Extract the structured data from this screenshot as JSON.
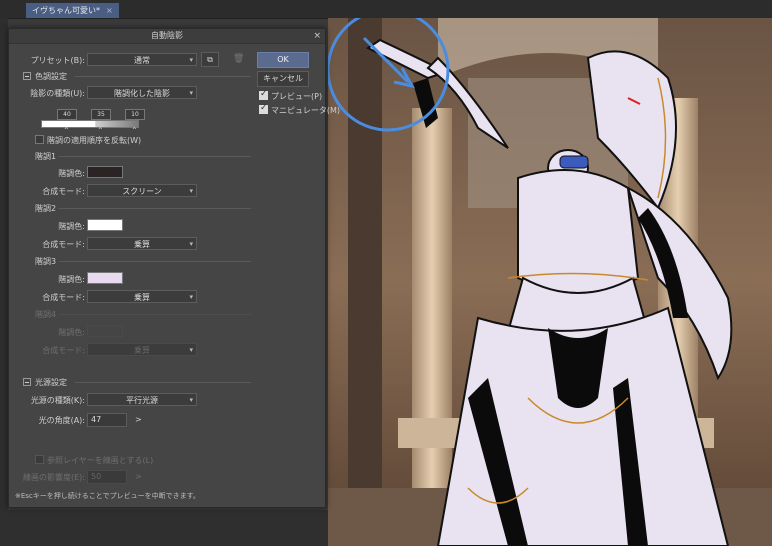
{
  "app": {
    "doc_tab": "イヴちゃん可愛い*",
    "doc_tab_close": "×"
  },
  "dialog": {
    "title": "自動陰影",
    "close": "×",
    "preset_label": "プリセット(B):",
    "preset_value": "通常",
    "ok": "OK",
    "cancel": "キャンセル",
    "preview_label": "プレビュー(P)",
    "preview_checked": true,
    "manipulator_label": "マニピュレータ(M)",
    "manipulator_checked": true,
    "tone_section": "色調設定",
    "shade_type_label": "陰影の種類(U):",
    "shade_type_value": "階調化した陰影",
    "gradient_values": [
      "40",
      "35",
      "10"
    ],
    "reverse_label": "階調の適用順序を反転(W)",
    "tones": [
      {
        "title": "階調1",
        "color_label": "階調色:",
        "color": "#2b2424",
        "blend_label": "合成モード:",
        "blend": "スクリーン"
      },
      {
        "title": "階調2",
        "color_label": "階調色:",
        "color": "#ffffff",
        "blend_label": "合成モード:",
        "blend": "乗算"
      },
      {
        "title": "階調3",
        "color_label": "階調色:",
        "color": "#e7d9ee",
        "blend_label": "合成モード:",
        "blend": "乗算"
      },
      {
        "title": "階調4",
        "color_label": "階調色:",
        "color": "#454545",
        "blend_label": "合成モード:",
        "blend": "乗算"
      }
    ],
    "light_section": "光源設定",
    "light_type_label": "光源の種類(K):",
    "light_type_value": "平行光源",
    "angle_label": "光の角度(A):",
    "angle_value": "47",
    "ref_layer_label": "参照レイヤーを線画とする(L)",
    "line_influence_label": "線画の影響度(E):",
    "line_influence_value": "50",
    "footer": "※Escキーを押し続けることでプレビューを中断できます。"
  },
  "icons": {
    "dropdown": "▾",
    "increment": ">",
    "preset_icon": "⧉",
    "trash": "🗑"
  },
  "colors": {
    "accent": "#5a6b8f",
    "manipulator": "#4a8de0"
  }
}
